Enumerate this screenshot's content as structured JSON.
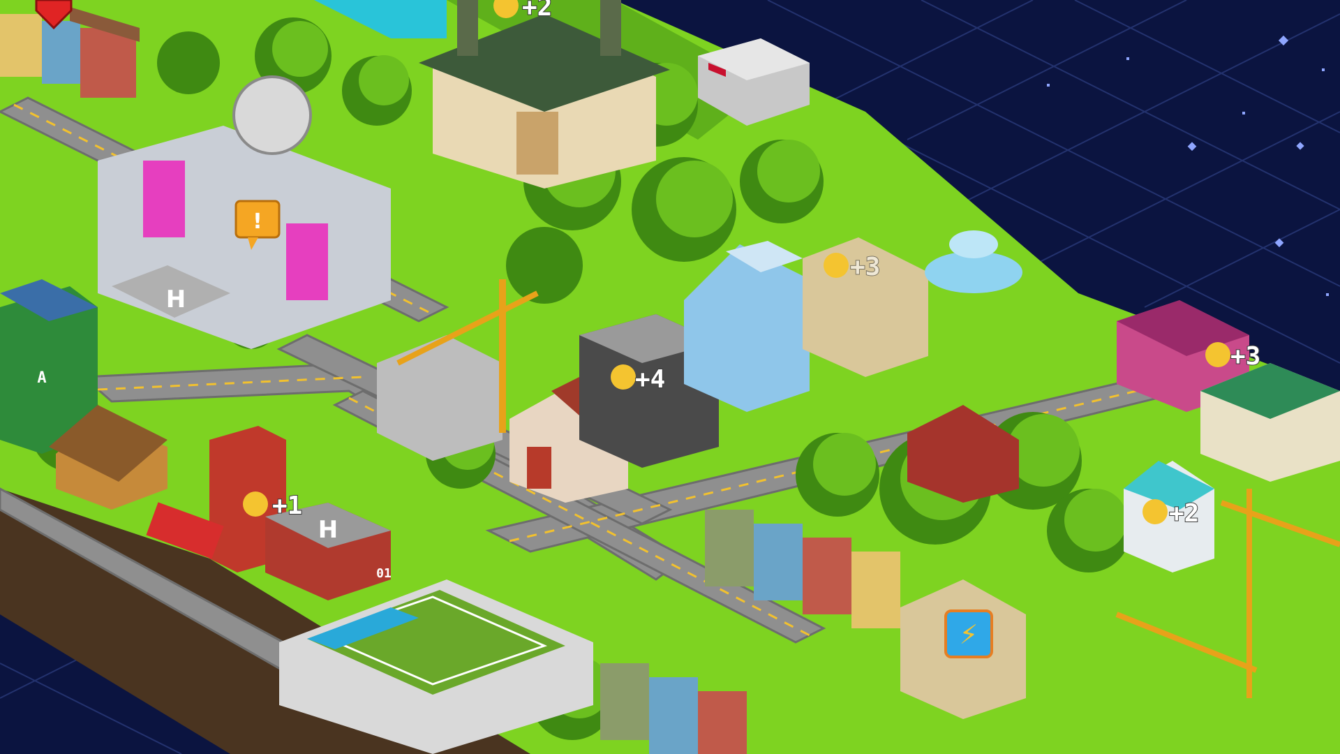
{
  "game": {
    "colors": {
      "space": "#0b1440",
      "grid_line": "#2a3a7a",
      "grass": "#7ed321",
      "grass_dark": "#4c9a17",
      "road": "#8f8f8f",
      "road_line": "#f2c12e",
      "cliff": "#4a3420",
      "tree": "#6bbf1f",
      "tree_dark": "#3f8a12",
      "coin": "#f4c430",
      "alert_badge": "#f5a623",
      "energy_badge": "#2fa8e8"
    },
    "coin_rewards": [
      {
        "id": "stadium-top",
        "label": "+2"
      },
      {
        "id": "police",
        "label": "+4"
      },
      {
        "id": "bank",
        "label": "+3"
      },
      {
        "id": "shop",
        "label": "+3"
      },
      {
        "id": "fire-station",
        "label": "+1"
      },
      {
        "id": "greenhouse",
        "label": "+2"
      }
    ],
    "badges": {
      "alert_icon": "exclamation-icon",
      "alert_symbol": "!",
      "energy_icon": "lightning-icon",
      "energy_symbol": "⚡",
      "heart_icon": "heart-icon"
    },
    "signs": {
      "helipad_letter": "H",
      "tower_letter": "A",
      "scoreboard": "01"
    }
  }
}
